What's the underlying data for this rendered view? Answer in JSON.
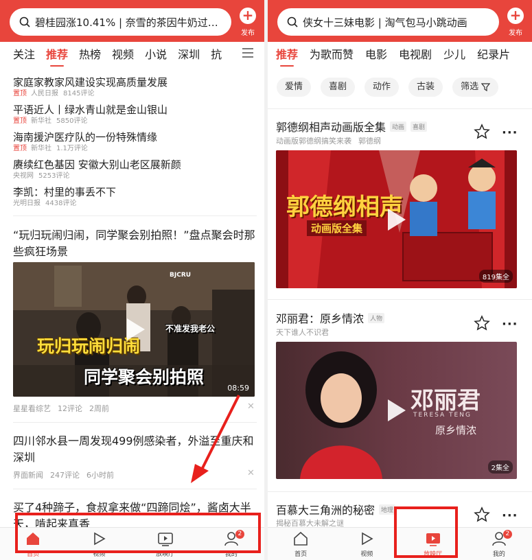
{
  "left": {
    "search": {
      "text": "碧桂园涨10.41% | 奈雪的茶因牛奶过期..."
    },
    "publish_label": "发布",
    "tabs": [
      {
        "label": "关注",
        "active": false
      },
      {
        "label": "推荐",
        "active": true
      },
      {
        "label": "热榜",
        "active": false
      },
      {
        "label": "视频",
        "active": false
      },
      {
        "label": "小说",
        "active": false
      },
      {
        "label": "深圳",
        "active": false
      },
      {
        "label": "抗",
        "active": false
      }
    ],
    "news": [
      {
        "title": "家庭家教家风建设实现高质量发展",
        "pinned": "置顶",
        "source": "人民日报",
        "comments": "8145评论"
      },
      {
        "title": "平语近人丨绿水青山就是金山银山",
        "pinned": "置顶",
        "source": "新华社",
        "comments": "5850评论"
      },
      {
        "title": "海南援沪医疗队的一份特殊情缘",
        "pinned": "置顶",
        "source": "新华社",
        "comments": "1.1万评论"
      },
      {
        "title": "赓续红色基因 安徽大别山老区展新颜",
        "pinned": "",
        "source": "央视网",
        "comments": "5253评论"
      },
      {
        "title": "李凯：村里的事丢不下",
        "pinned": "",
        "source": "光明日报",
        "comments": "4438评论"
      }
    ],
    "video_article": {
      "title": "“玩归玩闹归闹，同学聚会别拍照！”盘点聚会时那些疯狂场景",
      "overlay_main": "玩归玩闹归闹",
      "overlay_sub": "同学聚会别拍照",
      "overlay_small": "不准发我老公",
      "corner": "BJCRU",
      "duration": "08:59",
      "source": "星星看综艺",
      "comments": "12评论",
      "time": "2周前"
    },
    "article2": {
      "title": "四川邻水县一周发现499例感染者，外溢至重庆和深圳",
      "source": "界面新闻",
      "comments": "247评论",
      "time": "6小时前"
    },
    "article3": {
      "title": "买了4种蹄子，食叔拿来做“四蹄同烩”，酱卤大半天，啃起来真香"
    },
    "bottom_nav": [
      {
        "label": "首页",
        "icon": "home-icon",
        "active": true
      },
      {
        "label": "视频",
        "icon": "play-icon",
        "active": false
      },
      {
        "label": "放映厅",
        "icon": "cinema-icon",
        "active": false
      },
      {
        "label": "我的",
        "icon": "user-icon",
        "active": false,
        "badge": "2"
      }
    ]
  },
  "right": {
    "search": {
      "text": "侠女十三妹电影 | 淘气包马小跳动画"
    },
    "publish_label": "发布",
    "tabs": [
      {
        "label": "推荐",
        "active": true
      },
      {
        "label": "为歌而赞",
        "active": false
      },
      {
        "label": "电影",
        "active": false
      },
      {
        "label": "电视剧",
        "active": false
      },
      {
        "label": "少儿",
        "active": false
      },
      {
        "label": "纪录片",
        "active": false
      }
    ],
    "filters": [
      "爱情",
      "喜剧",
      "动作",
      "古装",
      "筛选"
    ],
    "cards": [
      {
        "title": "郭德纲相声动画版全集",
        "tags": [
          "动画",
          "喜剧"
        ],
        "subtitle": "动画版郭德纲搞笑来袭",
        "person": "郭德纲",
        "poster_title": "郭德纲相声",
        "poster_sub": "动画版全集",
        "episodes": "819集全"
      },
      {
        "title": "邓丽君：原乡情浓",
        "tags": [
          "人物"
        ],
        "subtitle": "天下谁人不识君",
        "person": "",
        "poster_title": "邓丽君",
        "poster_en": "TERESA TENG",
        "poster_sub": "原乡情浓",
        "episodes": "2集全"
      },
      {
        "title": "百慕大三角洲的秘密",
        "tags": [
          "地理"
        ],
        "subtitle": "揭秘百慕大未解之谜"
      }
    ],
    "bottom_nav": [
      {
        "label": "首页",
        "icon": "home-icon",
        "active": false
      },
      {
        "label": "视频",
        "icon": "play-icon",
        "active": false
      },
      {
        "label": "放映厅",
        "icon": "cinema-icon",
        "active": true
      },
      {
        "label": "我的",
        "icon": "user-icon",
        "active": false,
        "badge": "2"
      }
    ]
  },
  "colors": {
    "brand": "#e8453c",
    "annotation": "#e8201c"
  }
}
